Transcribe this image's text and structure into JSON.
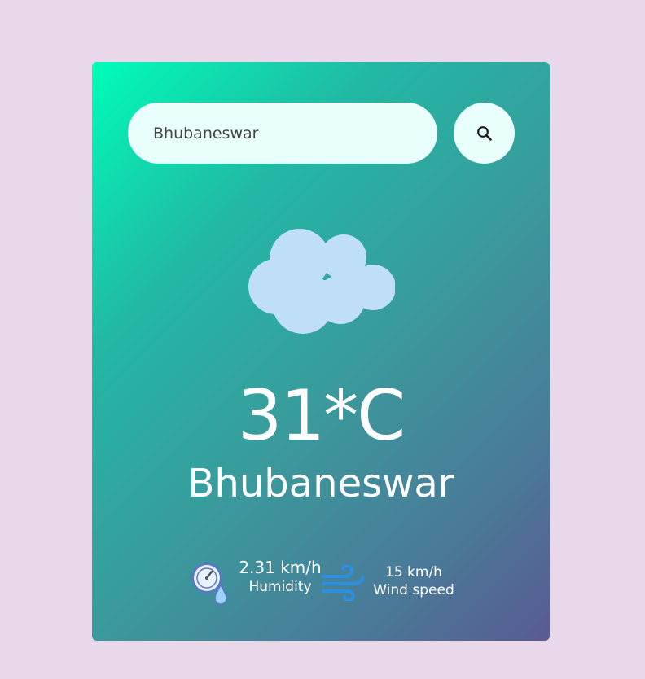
{
  "search": {
    "value": "Bhubaneswar",
    "button_icon": "search-icon"
  },
  "weather": {
    "icon": "cloud-icon",
    "temperature": "31*C",
    "city": "Bhubaneswar"
  },
  "details": {
    "humidity_value": "2.31 km/h",
    "humidity_label": "Humidity",
    "humidity_icon": "humidity-gauge-icon",
    "wind_value": "15 km/h",
    "wind_label": "Wind speed",
    "wind_icon": "wind-icon"
  },
  "colors": {
    "page_background": "#e8d8ea",
    "gradient_start": "#00fdb8",
    "gradient_end": "#5a5a92",
    "input_background": "#e8fffb",
    "cloud": "#bfdef8",
    "text": "#ffffff"
  }
}
